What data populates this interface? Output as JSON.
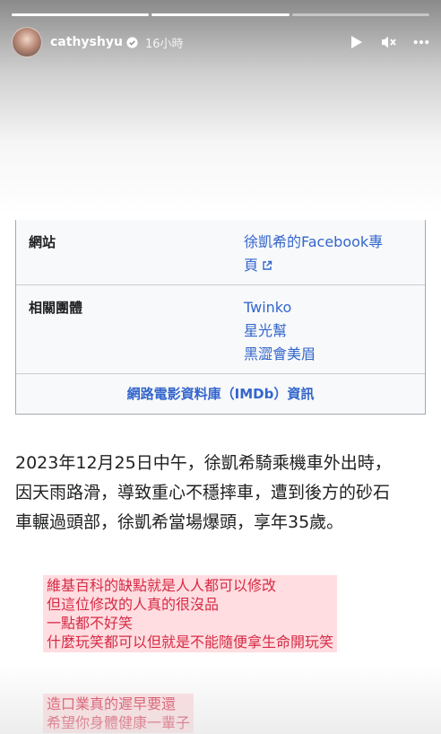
{
  "story": {
    "progress": [
      1.0,
      1.0,
      0.0
    ],
    "username": "cathyshyu",
    "timestamp": "16小時",
    "icons": [
      "play-icon",
      "mute-icon",
      "more-icon",
      "verified-badge-icon"
    ]
  },
  "infobox": {
    "rows": [
      {
        "label": "網站",
        "values": [
          "徐凱希的Facebook專",
          "頁"
        ]
      },
      {
        "label": "相關團體",
        "values": [
          "Twinko",
          "星光幫",
          "黑澀會美眉"
        ]
      }
    ],
    "footer": "網路電影資料庫（IMDb）資訊"
  },
  "article": {
    "lines": [
      "2023年12月25日中午，徐凱希騎乘機車外出時，",
      "因天雨路滑，導致重心不穩摔車，遭到後方的砂石",
      "車輾過頭部，徐凱希當場爆頭，享年35歲。"
    ]
  },
  "notes": [
    {
      "lines": [
        "維基百科的缺點就是人人都可以修改",
        "但這位修改的人真的很沒品",
        "一點都不好笑",
        "什麼玩笑都可以但就是不能隨便拿生命開玩笑"
      ]
    },
    {
      "lines": [
        "造口業真的遲早要還",
        "希望你身體健康一輩子"
      ]
    }
  ],
  "colors": {
    "link": "#3366cc",
    "note_text": "#d62b46",
    "note_bg": "#ffd2d6"
  }
}
